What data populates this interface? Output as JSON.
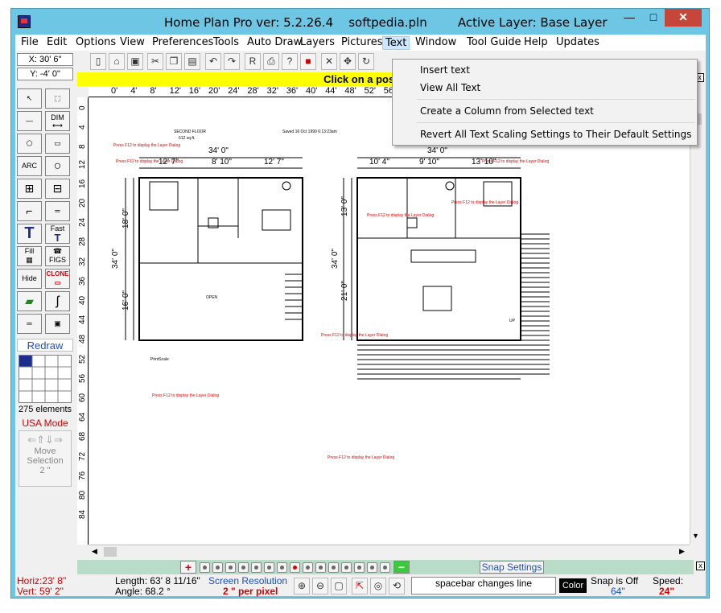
{
  "window": {
    "title": "Home Plan Pro ver: 5.2.26.4    softpedia.pln        Active Layer: Base Layer",
    "min_glyph": "—",
    "max_glyph": "□",
    "close_glyph": "✕"
  },
  "menu": [
    "File",
    "Edit",
    "Options",
    "View",
    "Preferences",
    "Tools",
    "Auto Draw",
    "Layers",
    "Pictures",
    "Text",
    "Window",
    "Tool Guide",
    "Help",
    "Updates"
  ],
  "coords": {
    "x": "X: 30' 6\"",
    "y": "Y: -4' 0\""
  },
  "hint": "Click on a position to clo",
  "hint_close": "x",
  "text_menu": {
    "items": [
      "Insert text",
      "View All Text",
      "Create a Column from Selected text",
      "Revert All Text Scaling Settings to Their Default Settings"
    ]
  },
  "palette": {
    "dim_label": "DIM",
    "arc_label": "ARC",
    "fast_label": "Fast",
    "fill_label": "Fill",
    "figs_label": "FIGS",
    "hide_label": "Hide",
    "clone_label": "CLONE",
    "t_label": "T",
    "redraw": "Redraw",
    "elements": "275 elements",
    "mode": "USA Mode",
    "move_label": "Move",
    "selection_label": "Selection",
    "move_step": "2 \""
  },
  "ruler_top": [
    "0'",
    "4'",
    "8'",
    "12'",
    "16'",
    "20'",
    "24'",
    "28'",
    "32'",
    "36'",
    "40'",
    "44'",
    "48'",
    "52'",
    "56'"
  ],
  "ruler_left": [
    "0",
    "4",
    "8",
    "12",
    "16",
    "20",
    "24",
    "28",
    "32",
    "36",
    "40",
    "44",
    "48",
    "52",
    "56",
    "60",
    "64",
    "68",
    "72",
    "76",
    "80",
    "84"
  ],
  "plan": {
    "second_floor": "SECOND FLOOR",
    "sq_ft": "612 sq.ft.",
    "saved": "Saved 16 Oct 1999  6:13:23am",
    "layer_hint": "Press    F12    to display the Layer Dialog",
    "open": "OPEN",
    "up": "UP",
    "print_scale": "PrintScale",
    "dims_left": {
      "total_w": "34' 0\"",
      "w1": "12' 7\"",
      "w2": "8' 10\"",
      "w3": "12' 7\"",
      "h_total": "34' 0\"",
      "h1": "18' 0\"",
      "h2": "16' 0\""
    },
    "dims_right": {
      "total_w": "34' 0\"",
      "w1": "10' 4\"",
      "w2": "9' 10\"",
      "w3": "13' 10\"",
      "h_total": "34' 0\"",
      "h1": "13' 0\"",
      "h2": "21' 0\""
    }
  },
  "layers": {
    "plus": "+",
    "minus": "−",
    "snap_settings": "Snap Settings"
  },
  "status": {
    "horiz": "Horiz:23' 8\"",
    "vert": "Vert: 59' 2\"",
    "length": "Length: 63' 8 11/16\"",
    "angle": "Angle:  68.2 °",
    "screen_res": "Screen Resolution",
    "per_pixel": "2 \" per pixel",
    "spacebar": "spacebar changes line",
    "color": "Color",
    "snap_off": "Snap is Off",
    "snap_val": "64\"",
    "speed": "Speed:",
    "speed_val": "24\""
  },
  "colors": {
    "titlebar": "#6dc6e3",
    "hint": "#ffff00",
    "accent_red": "#e00000",
    "link_blue": "#1a4fc7"
  }
}
